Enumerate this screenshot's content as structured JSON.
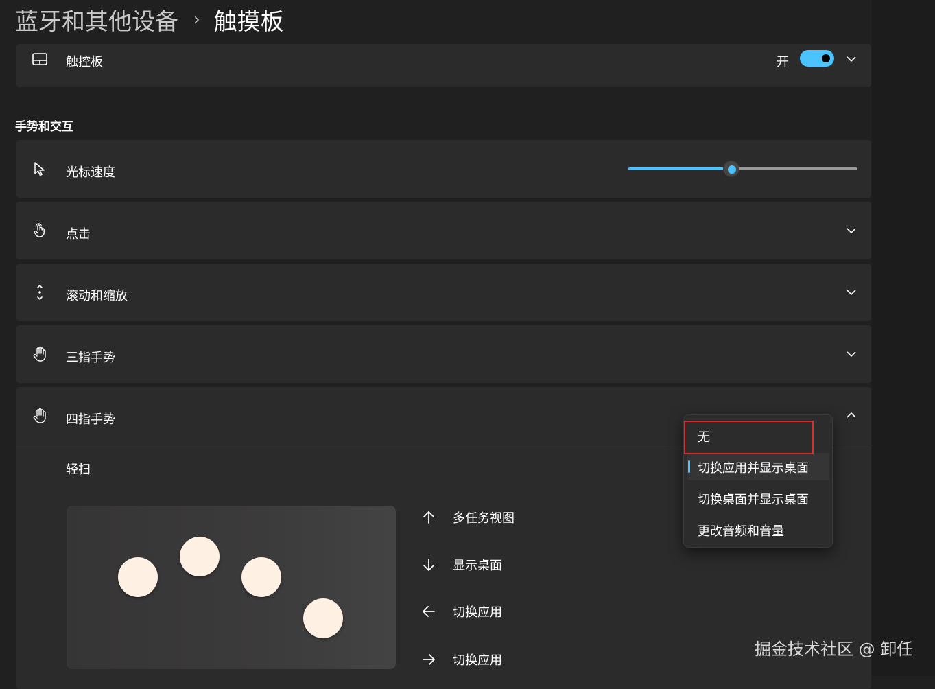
{
  "breadcrumb": {
    "parent": "蓝牙和其他设备",
    "separator": "›",
    "current": "触摸板"
  },
  "touchpad_card": {
    "icon": "touchpad-icon",
    "label": "触控板",
    "toggle_state_label": "开",
    "toggle_on": true
  },
  "section": {
    "title": "手势和交互"
  },
  "cursor_speed": {
    "icon": "cursor-icon",
    "label": "光标速度",
    "value_fraction": 0.45
  },
  "cards": {
    "tap": {
      "icon": "tap-icon",
      "label": "点击"
    },
    "scroll_zoom": {
      "icon": "scroll-icon",
      "label": "滚动和缩放"
    },
    "three_finger": {
      "icon": "hand-icon",
      "label": "三指手势"
    },
    "four_finger": {
      "icon": "hand-icon",
      "label": "四指手势",
      "expanded": true
    }
  },
  "swipe": {
    "label": "轻扫",
    "gestures": [
      {
        "direction": "up",
        "icon": "arrow-up-icon",
        "label": "多任务视图"
      },
      {
        "direction": "down",
        "icon": "arrow-down-icon",
        "label": "显示桌面"
      },
      {
        "direction": "left",
        "icon": "arrow-left-icon",
        "label": "切换应用"
      },
      {
        "direction": "right",
        "icon": "arrow-right-icon",
        "label": "切换应用"
      }
    ]
  },
  "dropdown": {
    "options": [
      "无",
      "切换应用并显示桌面",
      "切换桌面并显示桌面",
      "更改音频和音量"
    ],
    "selected": "切换应用并显示桌面",
    "highlighted": "无"
  },
  "colors": {
    "accent": "#4cc2ff",
    "background": "#202020",
    "card": "#2b2b2b",
    "highlight_box": "#d82d2d",
    "finger": "#fff0e4"
  },
  "watermark": "掘金技术社区 @ 卸任"
}
